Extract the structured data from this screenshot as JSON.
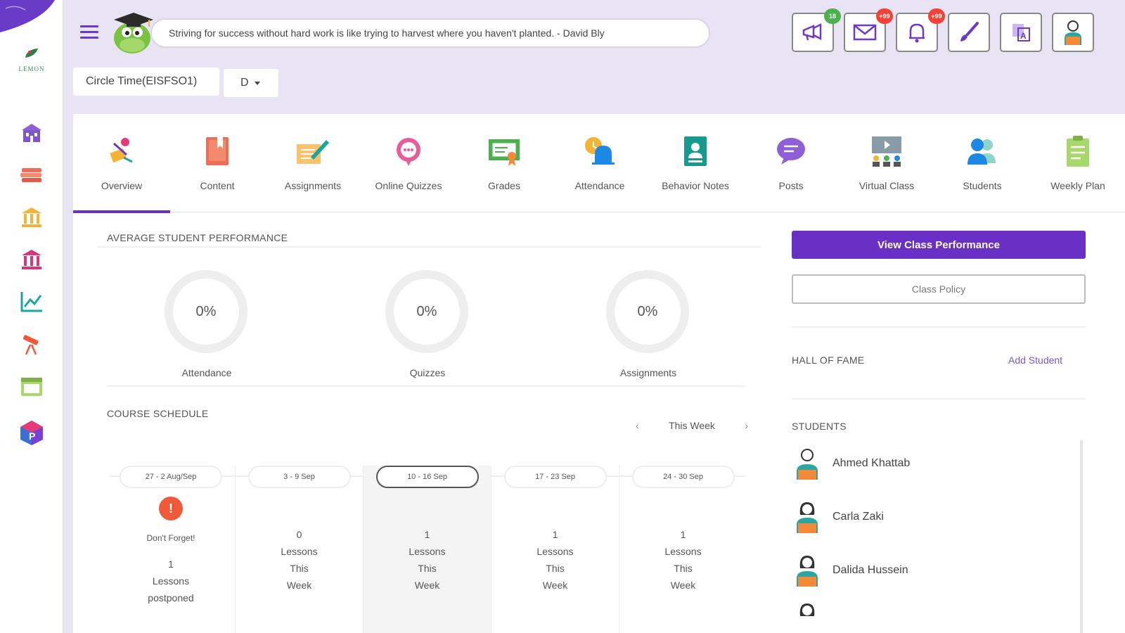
{
  "quote": "Striving for success without hard work is like trying to harvest where you haven't planted. - David Bly",
  "top_icons": [
    {
      "icon": "megaphone-icon",
      "badge": "18",
      "badge_color": "#4caf50"
    },
    {
      "icon": "mail-icon",
      "badge": "+99",
      "badge_color": "#f44336"
    },
    {
      "icon": "bell-icon",
      "badge": "+99",
      "badge_color": "#f44336"
    },
    {
      "icon": "paintbrush-icon",
      "badge": "",
      "badge_color": ""
    },
    {
      "icon": "translate-icon",
      "badge": "",
      "badge_color": ""
    },
    {
      "icon": "profile-icon",
      "badge": "",
      "badge_color": ""
    }
  ],
  "class_selector": {
    "label": "Circle Time(EISFSO1)",
    "section": "D"
  },
  "tabs": [
    {
      "label": "Overview",
      "icon": "overview-icon",
      "active": true
    },
    {
      "label": "Content",
      "icon": "book-icon",
      "active": false
    },
    {
      "label": "Assignments",
      "icon": "pencil-note-icon",
      "active": false
    },
    {
      "label": "Online Quizzes",
      "icon": "chat-bubble-icon",
      "active": false
    },
    {
      "label": "Grades",
      "icon": "certificate-icon",
      "active": false
    },
    {
      "label": "Attendance",
      "icon": "alarm-bell-icon",
      "active": false
    },
    {
      "label": "Behavior Notes",
      "icon": "id-card-icon",
      "active": false
    },
    {
      "label": "Posts",
      "icon": "speech-bubble-icon",
      "active": false
    },
    {
      "label": "Virtual Class",
      "icon": "video-class-icon",
      "active": false
    },
    {
      "label": "Students",
      "icon": "students-icon",
      "active": false
    },
    {
      "label": "Weekly Plan",
      "icon": "clipboard-icon",
      "active": false
    }
  ],
  "performance": {
    "title": "Average Student Performance",
    "gauges": [
      {
        "value": "0%",
        "label": "Attendance"
      },
      {
        "value": "0%",
        "label": "Quizzes"
      },
      {
        "value": "0%",
        "label": "Assignments"
      }
    ]
  },
  "schedule": {
    "title": "Course Schedule",
    "nav_label": "This Week",
    "prev_icon": "‹",
    "next_icon": "›",
    "weeks": [
      {
        "range": "27 - 2 Aug/Sep",
        "alert": "!",
        "note": "Don't Forget!",
        "count": "1",
        "line1": "Lessons",
        "line2": "postponed",
        "current": false
      },
      {
        "range": "3 - 9 Sep",
        "count": "0",
        "line1": "Lessons",
        "line2": "This",
        "line3": "Week",
        "current": false
      },
      {
        "range": "10 - 16 Sep",
        "count": "1",
        "line1": "Lessons",
        "line2": "This",
        "line3": "Week",
        "current": true
      },
      {
        "range": "17 - 23 Sep",
        "count": "1",
        "line1": "Lessons",
        "line2": "This",
        "line3": "Week",
        "current": false
      },
      {
        "range": "24 - 30 Sep",
        "count": "1",
        "line1": "Lessons",
        "line2": "This",
        "line3": "Week",
        "current": false
      }
    ]
  },
  "right_panel": {
    "view_performance": "View Class Performance",
    "class_policy": "Class Policy",
    "hall_of_fame": "Hall of Fame",
    "add_student": "Add Student",
    "students_title": "Students",
    "students": [
      {
        "name": "Ahmed Khattab",
        "gender": "male"
      },
      {
        "name": "Carla Zaki",
        "gender": "female"
      },
      {
        "name": "Dalida Hussein",
        "gender": "female"
      }
    ]
  },
  "colors": {
    "accent": "#6a2fc4",
    "alert": "#f05a3a"
  }
}
